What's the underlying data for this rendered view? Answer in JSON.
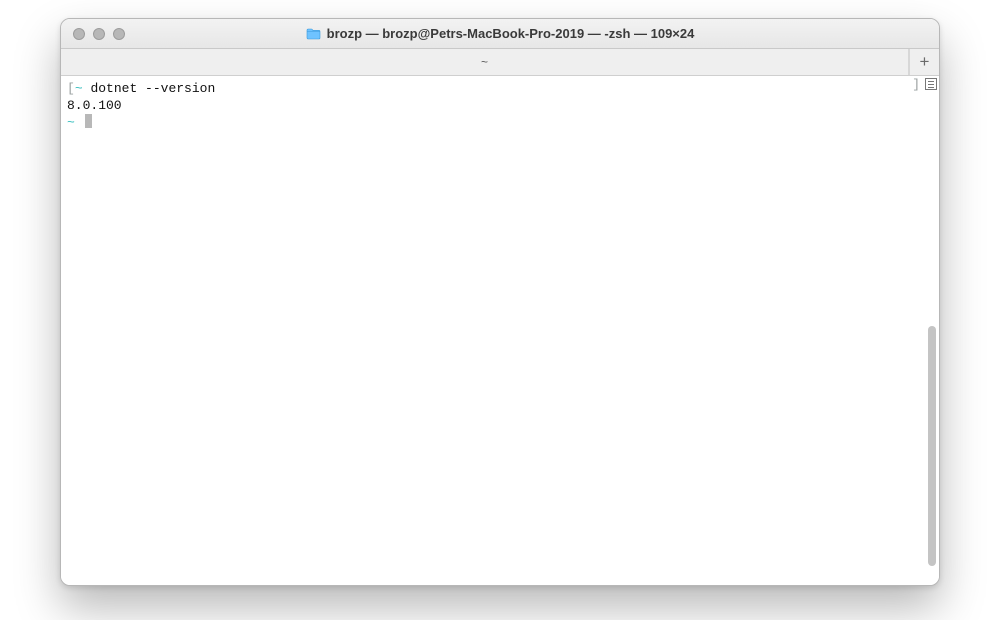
{
  "window": {
    "title": "brozp — brozp@Petrs-MacBook-Pro-2019 — -zsh — 109×24"
  },
  "tabs": {
    "current_label": "~",
    "new_tab_glyph": "+"
  },
  "terminal": {
    "open_bracket": "[",
    "close_bracket": "]",
    "prompt1_tilde": "~",
    "command1": "dotnet --version",
    "output1": "8.0.100",
    "prompt2_tilde": "~"
  }
}
